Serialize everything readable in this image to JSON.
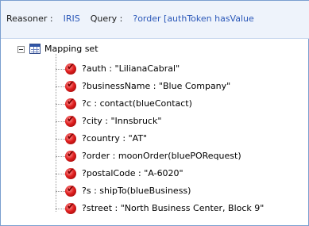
{
  "header": {
    "reasoner_label": "Reasoner :",
    "reasoner_value": "IRIS",
    "query_label": "Query :",
    "query_value": "?order [authToken hasValue"
  },
  "tree": {
    "root_label": "Mapping set",
    "root_icon": "table-icon",
    "item_icon": "check-mark-icon",
    "items": [
      "?auth : \"LilianaCabral\"",
      "?businessName : \"Blue Company\"",
      "?c : contact(blueContact)",
      "?city : \"Innsbruck\"",
      "?country : \"AT\"",
      "?order : moonOrder(bluePORequest)",
      "?postalCode : \"A-6020\"",
      "?s : shipTo(blueBusiness)",
      "?street : \"North Business Center, Block 9\""
    ]
  }
}
